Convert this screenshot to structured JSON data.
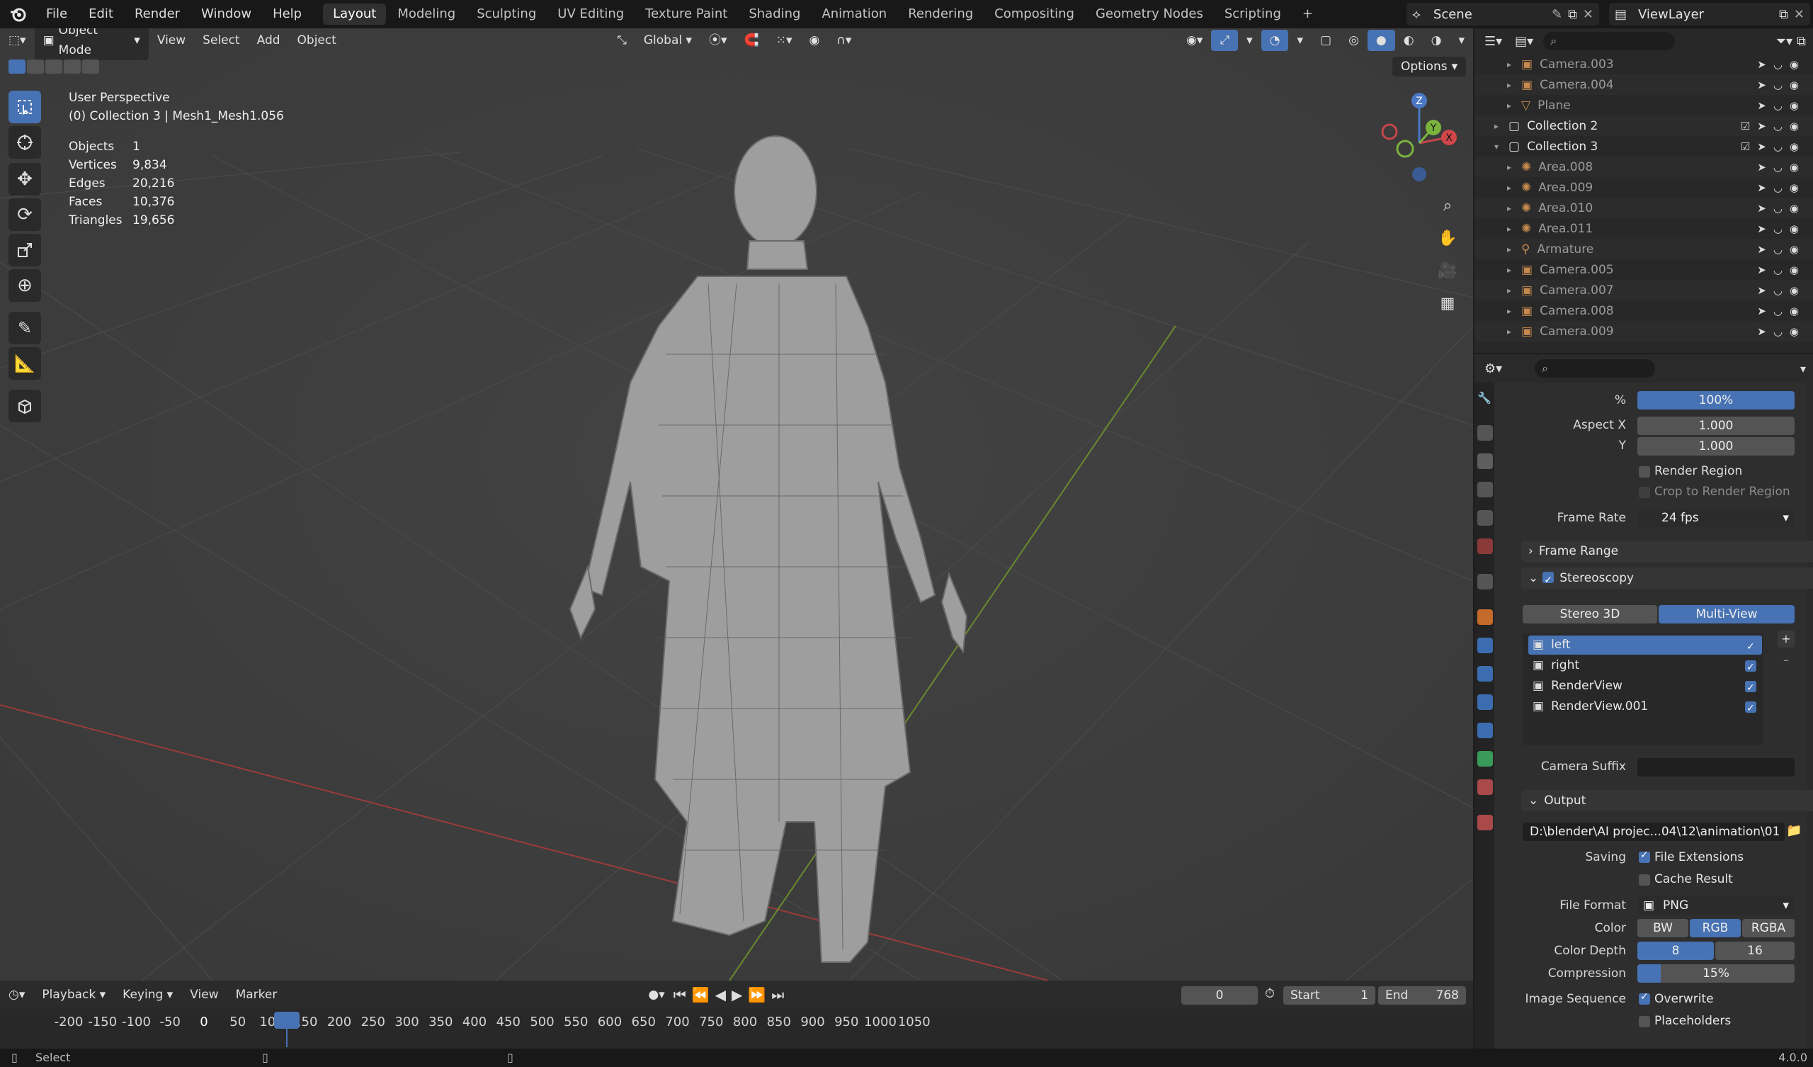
{
  "menu": {
    "items": [
      "File",
      "Edit",
      "Render",
      "Window",
      "Help"
    ],
    "workspaces": [
      "Layout",
      "Modeling",
      "Sculpting",
      "UV Editing",
      "Texture Paint",
      "Shading",
      "Animation",
      "Rendering",
      "Compositing",
      "Geometry Nodes",
      "Scripting"
    ],
    "active_workspace": "Layout",
    "scene_label": "Scene",
    "viewlayer_label": "ViewLayer"
  },
  "viewport": {
    "mode": "Object Mode",
    "menus": [
      "View",
      "Select",
      "Add",
      "Object"
    ],
    "orientation": "Global",
    "options_label": "Options",
    "view_name": "User Perspective",
    "collection_info": "(0) Collection 3 | Mesh1_Mesh1.056",
    "stats": [
      {
        "label": "Objects",
        "value": "1"
      },
      {
        "label": "Vertices",
        "value": "9,834"
      },
      {
        "label": "Edges",
        "value": "20,216"
      },
      {
        "label": "Faces",
        "value": "10,376"
      },
      {
        "label": "Triangles",
        "value": "19,656"
      }
    ],
    "gizmo_axes": [
      "Z",
      "Y",
      "X"
    ]
  },
  "timeline": {
    "menus": [
      "Playback",
      "Keying",
      "View",
      "Marker"
    ],
    "current_frame": "0",
    "start_label": "Start",
    "start_value": "1",
    "end_label": "End",
    "end_value": "768",
    "ticks": [
      "-200",
      "-150",
      "-100",
      "-50",
      "0",
      "50",
      "100",
      "150",
      "200",
      "250",
      "300",
      "350",
      "400",
      "450",
      "500",
      "550",
      "600",
      "650",
      "700",
      "750",
      "800",
      "850",
      "900",
      "950",
      "1000",
      "1050"
    ]
  },
  "statusbar": {
    "left": "Select",
    "version": "4.0.0"
  },
  "outliner": {
    "rows": [
      {
        "name": "Camera.003",
        "indent": 2,
        "type": "camera"
      },
      {
        "name": "Camera.004",
        "indent": 2,
        "type": "camera"
      },
      {
        "name": "Plane",
        "indent": 2,
        "type": "mesh"
      },
      {
        "name": "Collection 2",
        "indent": 1,
        "type": "collection"
      },
      {
        "name": "Collection 3",
        "indent": 1,
        "type": "collection"
      },
      {
        "name": "Area.008",
        "indent": 2,
        "type": "light"
      },
      {
        "name": "Area.009",
        "indent": 2,
        "type": "light"
      },
      {
        "name": "Area.010",
        "indent": 2,
        "type": "light"
      },
      {
        "name": "Area.011",
        "indent": 2,
        "type": "light"
      },
      {
        "name": "Armature",
        "indent": 2,
        "type": "armature"
      },
      {
        "name": "Camera.005",
        "indent": 2,
        "type": "camera"
      },
      {
        "name": "Camera.007",
        "indent": 2,
        "type": "camera"
      },
      {
        "name": "Camera.008",
        "indent": 2,
        "type": "camera"
      },
      {
        "name": "Camera.009",
        "indent": 2,
        "type": "camera"
      }
    ]
  },
  "properties": {
    "percent_label": "%",
    "percent_value": "100%",
    "aspect_x_label": "Aspect X",
    "aspect_x": "1.000",
    "aspect_y_label": "Y",
    "aspect_y": "1.000",
    "render_region": "Render Region",
    "crop_region": "Crop to Render Region",
    "frame_rate_label": "Frame Rate",
    "frame_rate": "24 fps",
    "frame_range_section": "Frame Range",
    "stereoscopy_section": "Stereoscopy",
    "stereo_mode_a": "Stereo 3D",
    "stereo_mode_b": "Multi-View",
    "views": [
      "left",
      "right",
      "RenderView",
      "RenderView.001"
    ],
    "camera_suffix_label": "Camera Suffix",
    "output_section": "Output",
    "output_path": "D:\\blender\\AI projec...04\\12\\animation\\01",
    "saving_label": "Saving",
    "file_extensions": "File Extensions",
    "cache_result": "Cache Result",
    "file_format_label": "File Format",
    "file_format": "PNG",
    "color_label": "Color",
    "color_options": [
      "BW",
      "RGB",
      "RGBA"
    ],
    "color_active": "RGB",
    "color_depth_label": "Color Depth",
    "color_depth_options": [
      "8",
      "16"
    ],
    "compression_label": "Compression",
    "compression_value": "15%",
    "compression_fraction": 0.15,
    "image_sequence_label": "Image Sequence",
    "overwrite": "Overwrite",
    "placeholders": "Placeholders"
  }
}
